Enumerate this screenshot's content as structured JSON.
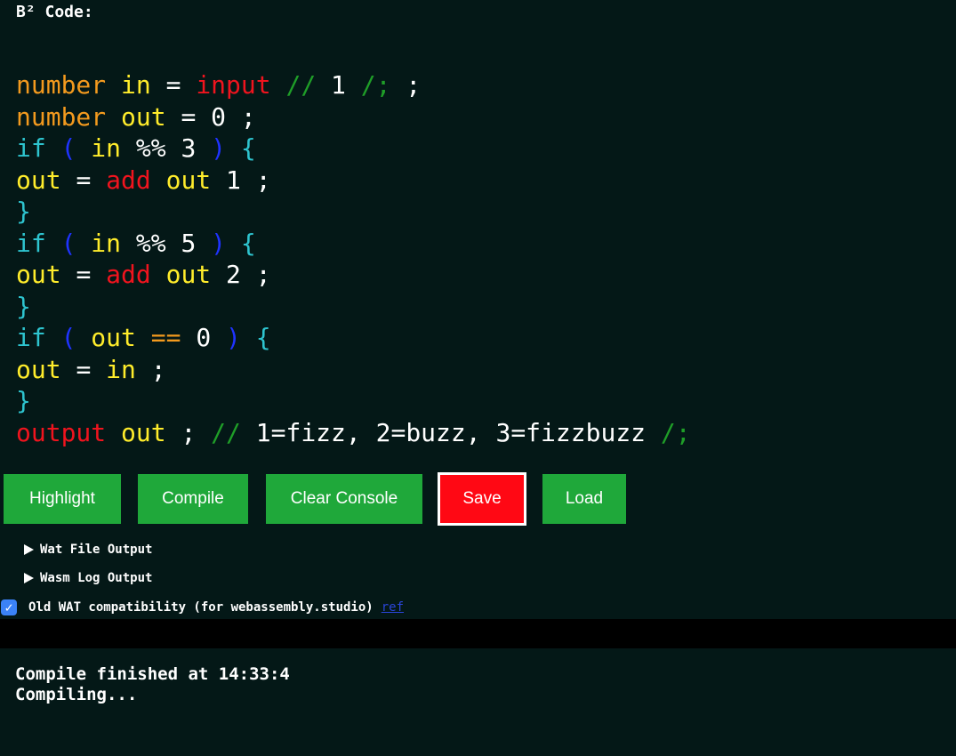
{
  "header": {
    "label": "B² Code:"
  },
  "colors": {
    "background": "#041817",
    "type": "#f39a1e",
    "ident": "#ffec2b",
    "builtin": "#f0141e",
    "comment": "#1f9e28",
    "keyword": "#2ec4cf",
    "paren": "#1f33ff",
    "brace": "#2ec4cf",
    "op": "#ffffff",
    "number": "#ffffff",
    "compare": "#f39a1e"
  },
  "code_lines": [
    [
      {
        "t": "number",
        "c": "type"
      },
      {
        "t": " "
      },
      {
        "t": "in",
        "c": "ident"
      },
      {
        "t": " "
      },
      {
        "t": "=",
        "c": "op"
      },
      {
        "t": " "
      },
      {
        "t": "input",
        "c": "builtin"
      },
      {
        "t": " "
      },
      {
        "t": "//",
        "c": "comment"
      },
      {
        "t": " "
      },
      {
        "t": "1",
        "c": "number"
      },
      {
        "t": " "
      },
      {
        "t": "/;",
        "c": "comment"
      },
      {
        "t": " "
      },
      {
        "t": ";",
        "c": "op"
      }
    ],
    [
      {
        "t": "number",
        "c": "type"
      },
      {
        "t": " "
      },
      {
        "t": "out",
        "c": "ident"
      },
      {
        "t": " "
      },
      {
        "t": "=",
        "c": "op"
      },
      {
        "t": " "
      },
      {
        "t": "0",
        "c": "number"
      },
      {
        "t": " "
      },
      {
        "t": ";",
        "c": "op"
      }
    ],
    [
      {
        "t": "if",
        "c": "keyword"
      },
      {
        "t": " "
      },
      {
        "t": "(",
        "c": "paren"
      },
      {
        "t": " "
      },
      {
        "t": "in",
        "c": "ident"
      },
      {
        "t": " "
      },
      {
        "t": "%%",
        "c": "op"
      },
      {
        "t": " "
      },
      {
        "t": "3",
        "c": "number"
      },
      {
        "t": " "
      },
      {
        "t": ")",
        "c": "paren"
      },
      {
        "t": " "
      },
      {
        "t": "{",
        "c": "brace"
      }
    ],
    [
      {
        "t": "out",
        "c": "ident"
      },
      {
        "t": " "
      },
      {
        "t": "=",
        "c": "op"
      },
      {
        "t": " "
      },
      {
        "t": "add",
        "c": "builtin"
      },
      {
        "t": " "
      },
      {
        "t": "out",
        "c": "ident"
      },
      {
        "t": " "
      },
      {
        "t": "1",
        "c": "number"
      },
      {
        "t": " "
      },
      {
        "t": ";",
        "c": "op"
      }
    ],
    [
      {
        "t": "}",
        "c": "brace"
      }
    ],
    [
      {
        "t": "if",
        "c": "keyword"
      },
      {
        "t": " "
      },
      {
        "t": "(",
        "c": "paren"
      },
      {
        "t": " "
      },
      {
        "t": "in",
        "c": "ident"
      },
      {
        "t": " "
      },
      {
        "t": "%%",
        "c": "op"
      },
      {
        "t": " "
      },
      {
        "t": "5",
        "c": "number"
      },
      {
        "t": " "
      },
      {
        "t": ")",
        "c": "paren"
      },
      {
        "t": " "
      },
      {
        "t": "{",
        "c": "brace"
      }
    ],
    [
      {
        "t": "out",
        "c": "ident"
      },
      {
        "t": " "
      },
      {
        "t": "=",
        "c": "op"
      },
      {
        "t": " "
      },
      {
        "t": "add",
        "c": "builtin"
      },
      {
        "t": " "
      },
      {
        "t": "out",
        "c": "ident"
      },
      {
        "t": " "
      },
      {
        "t": "2",
        "c": "number"
      },
      {
        "t": " "
      },
      {
        "t": ";",
        "c": "op"
      }
    ],
    [
      {
        "t": "}",
        "c": "brace"
      }
    ],
    [
      {
        "t": "if",
        "c": "keyword"
      },
      {
        "t": " "
      },
      {
        "t": "(",
        "c": "paren"
      },
      {
        "t": " "
      },
      {
        "t": "out",
        "c": "ident"
      },
      {
        "t": " "
      },
      {
        "t": "==",
        "c": "compare"
      },
      {
        "t": " "
      },
      {
        "t": "0",
        "c": "number"
      },
      {
        "t": " "
      },
      {
        "t": ")",
        "c": "paren"
      },
      {
        "t": " "
      },
      {
        "t": "{",
        "c": "brace"
      }
    ],
    [
      {
        "t": "out",
        "c": "ident"
      },
      {
        "t": " "
      },
      {
        "t": "=",
        "c": "op"
      },
      {
        "t": " "
      },
      {
        "t": "in",
        "c": "ident"
      },
      {
        "t": " "
      },
      {
        "t": ";",
        "c": "op"
      }
    ],
    [
      {
        "t": "}",
        "c": "brace"
      }
    ],
    [
      {
        "t": "output",
        "c": "builtin"
      },
      {
        "t": " "
      },
      {
        "t": "out",
        "c": "ident"
      },
      {
        "t": " "
      },
      {
        "t": ";",
        "c": "op"
      },
      {
        "t": " "
      },
      {
        "t": "//",
        "c": "comment"
      },
      {
        "t": " "
      },
      {
        "t": "1=fizz, 2=buzz, 3=fizzbuzz",
        "c": "number"
      },
      {
        "t": " "
      },
      {
        "t": "/;",
        "c": "comment"
      }
    ]
  ],
  "toolbar": {
    "highlight_label": "Highlight",
    "compile_label": "Compile",
    "clear_console_label": "Clear Console",
    "save_label": "Save",
    "load_label": "Load"
  },
  "panels": {
    "wat_output_label": "Wat File Output",
    "wasm_log_label": "Wasm Log Output"
  },
  "options": {
    "compat_checked": true,
    "compat_label": "Old WAT compatibility (for webassembly.studio)",
    "ref_link_label": "ref"
  },
  "console": {
    "lines": [
      "Compile finished at 14:33:4",
      "Compiling..."
    ]
  }
}
